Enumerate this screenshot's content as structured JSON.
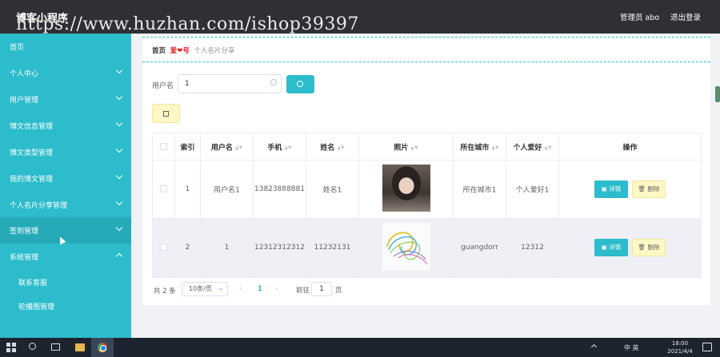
{
  "header": {
    "app_title": "博客小程序",
    "admin_label": "管理员 abo",
    "logout_label": "退出登录",
    "watermark": "https://www.huzhan.com/ishop39397"
  },
  "sidebar": {
    "items": [
      {
        "label": "首页"
      },
      {
        "label": "个人中心"
      },
      {
        "label": "用户管理"
      },
      {
        "label": "博文信息管理"
      },
      {
        "label": "博文类型管理"
      },
      {
        "label": "我的博文管理"
      },
      {
        "label": "个人名片分享管理"
      },
      {
        "label": "签到管理"
      },
      {
        "label": "系统管理"
      }
    ],
    "sub_items": [
      {
        "label": "联系客服"
      },
      {
        "label": "轮播图管理"
      }
    ]
  },
  "breadcrumb": {
    "home": "首页",
    "separator": "爱❤号",
    "current": "个人名片分享"
  },
  "search": {
    "label": "用户名",
    "value": "1"
  },
  "table": {
    "headers": [
      "索引",
      "用户名",
      "手机",
      "姓名",
      "照片",
      "所在城市",
      "个人爱好",
      "操作"
    ],
    "rows": [
      {
        "index": "1",
        "username": "用户名1",
        "phone": "13823888881",
        "name": "姓名1",
        "city": "所在城市1",
        "hobby": "个人爱好1"
      },
      {
        "index": "2",
        "username": "1",
        "phone": "12312312312",
        "name": "11232131",
        "city": "guangdorr",
        "hobby": "12312"
      }
    ],
    "detail_label": "详情",
    "delete_label": "删除"
  },
  "pagination": {
    "total": "共 2 条",
    "page_size": "10条/页",
    "current_page": "1",
    "goto_label": "前往",
    "goto_value": "1",
    "goto_suffix": "页"
  },
  "taskbar": {
    "tray_text": "中 英",
    "time": "18:00",
    "date": "2021/4/4"
  },
  "colors": {
    "accent": "#2cbccc",
    "topbar": "#2f3035",
    "delete_bg": "#fff8c5"
  }
}
